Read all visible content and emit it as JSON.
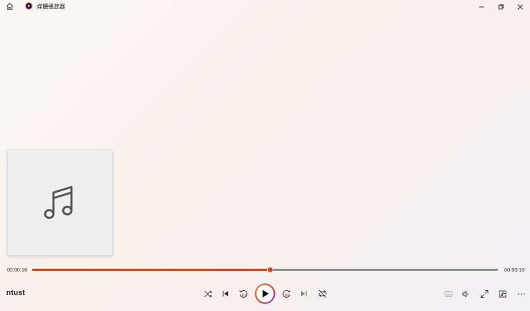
{
  "titlebar": {
    "app_title": "媒體播放器",
    "home_icon": "home-icon",
    "app_icon": "media-player-icon",
    "minimize_icon": "minimize-icon",
    "restore_icon": "restore-icon",
    "close_icon": "close-icon"
  },
  "album_art": {
    "icon": "music-note-icon"
  },
  "playback": {
    "elapsed": "00:00:16",
    "duration": "00:00:16",
    "progress_fraction": 0.51,
    "accent_color": "#c4481b"
  },
  "now_playing": {
    "title": "ntust"
  },
  "controls": {
    "shuffle": "shuffle-icon",
    "previous": "previous-icon",
    "skip_back": "skip-back-10-icon",
    "play": "play-icon",
    "skip_forward": "skip-forward-30-icon",
    "next": "next-icon",
    "repeat": "repeat-off-icon",
    "subtitles": "subtitles-icon",
    "volume": "volume-icon",
    "fullscreen": "fullscreen-icon",
    "mini_player": "mini-player-icon",
    "more": "more-icon"
  }
}
